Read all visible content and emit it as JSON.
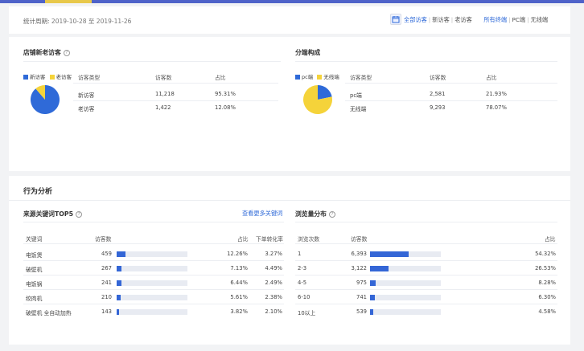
{
  "header": {
    "period_label": "统计周期:",
    "date_start": "2019-10-28",
    "date_sep": "至",
    "date_end": "2019-11-26",
    "calendar_icon": "calendar-icon",
    "visitor_filters": [
      "全部访客",
      "新访客",
      "老访客"
    ],
    "visitor_active": 0,
    "device_filters": [
      "所有终端",
      "PC端",
      "无线端"
    ],
    "device_active": 0
  },
  "store_visitors": {
    "title": "店铺新老访客",
    "legend": [
      {
        "label": "新访客",
        "color": "#2f6ad8"
      },
      {
        "label": "老访客",
        "color": "#f5d33a"
      }
    ],
    "columns": [
      "访客类型",
      "访客数",
      "占比"
    ],
    "rows": [
      {
        "type": "新访客",
        "count": "11,218",
        "pct": "95.31%"
      },
      {
        "type": "老访客",
        "count": "1,422",
        "pct": "12.08%"
      }
    ]
  },
  "device_split": {
    "title": "分端构成",
    "legend": [
      {
        "label": "pc端",
        "color": "#2f6ad8"
      },
      {
        "label": "无线端",
        "color": "#f5d33a"
      }
    ],
    "columns": [
      "访客类型",
      "访客数",
      "占比"
    ],
    "rows": [
      {
        "type": "pc端",
        "count": "2,581",
        "pct": "21.93%"
      },
      {
        "type": "无线端",
        "count": "9,293",
        "pct": "78.07%"
      }
    ]
  },
  "behavior": {
    "title": "行为分析",
    "keywords": {
      "title": "来源关键词TOP5",
      "more_link": "查看更多关键词",
      "columns": [
        "关键词",
        "访客数",
        "占比",
        "下单转化率"
      ],
      "rows": [
        {
          "keyword": "电饭煲",
          "visitors": "459",
          "share": 0.1226,
          "pct": "12.26%",
          "conv": "3.27%"
        },
        {
          "keyword": "破壁机",
          "visitors": "267",
          "share": 0.0713,
          "pct": "7.13%",
          "conv": "4.49%"
        },
        {
          "keyword": "电饭锅",
          "visitors": "241",
          "share": 0.0644,
          "pct": "6.44%",
          "conv": "2.49%"
        },
        {
          "keyword": "绞肉机",
          "visitors": "210",
          "share": 0.0561,
          "pct": "5.61%",
          "conv": "2.38%"
        },
        {
          "keyword": "破壁机 全自动加热",
          "visitors": "143",
          "share": 0.0382,
          "pct": "3.82%",
          "conv": "2.10%"
        }
      ]
    },
    "pageviews": {
      "title": "浏览量分布",
      "columns": [
        "浏览次数",
        "访客数",
        "占比"
      ],
      "rows": [
        {
          "range": "1",
          "visitors": "6,393",
          "share": 0.5432,
          "pct": "54.32%"
        },
        {
          "range": "2-3",
          "visitors": "3,122",
          "share": 0.2653,
          "pct": "26.53%"
        },
        {
          "range": "4-5",
          "visitors": "975",
          "share": 0.0828,
          "pct": "8.28%"
        },
        {
          "range": "6-10",
          "visitors": "741",
          "share": 0.063,
          "pct": "6.30%"
        },
        {
          "range": "10以上",
          "visitors": "539",
          "share": 0.0458,
          "pct": "4.58%"
        }
      ]
    }
  }
}
